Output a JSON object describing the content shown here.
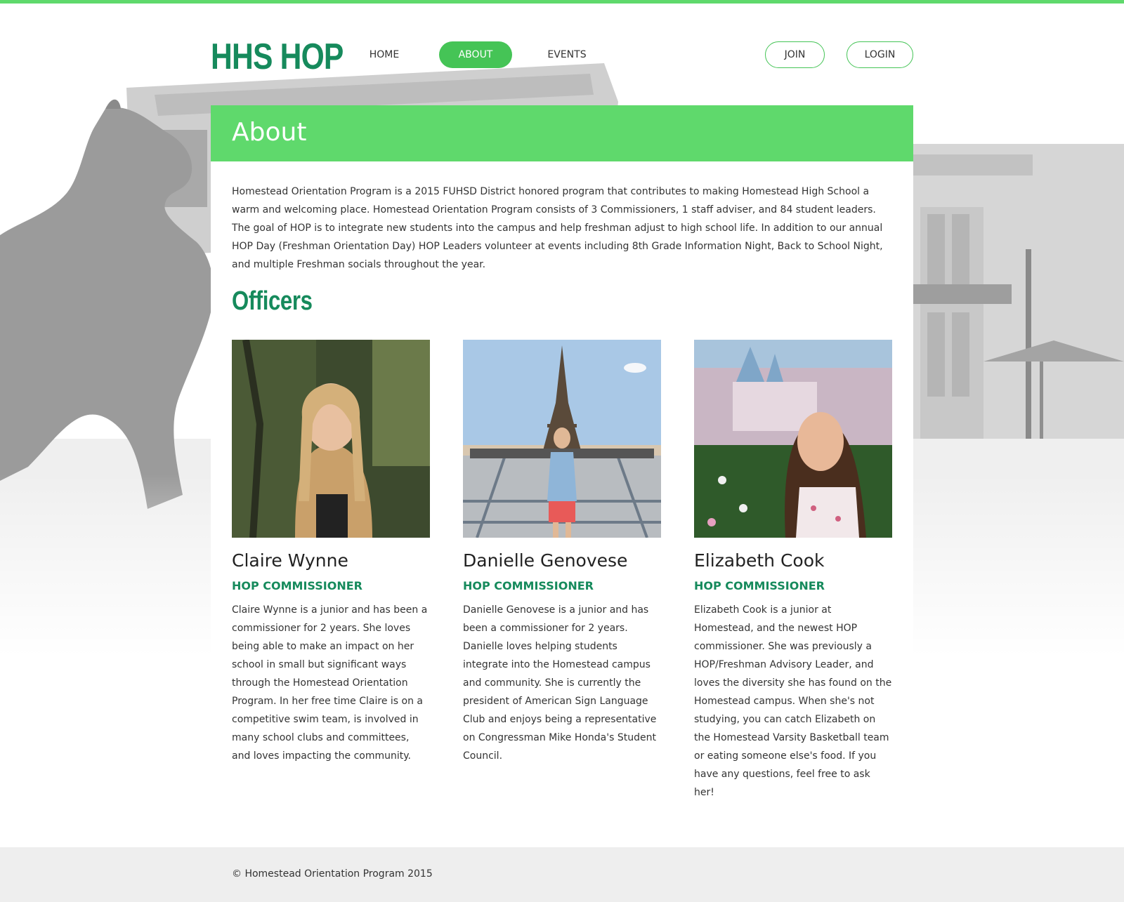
{
  "brand": {
    "logo": "HHS HOP",
    "accent": "#45c456",
    "brand_green": "#168a5c"
  },
  "nav": {
    "items": [
      {
        "label": "HOME",
        "active": false
      },
      {
        "label": "ABOUT",
        "active": true
      },
      {
        "label": "EVENTS",
        "active": false
      }
    ],
    "join_label": "JOIN",
    "login_label": "LOGIN"
  },
  "page": {
    "title": "About",
    "intro": "Homestead Orientation Program is a 2015 FUHSD District honored program that contributes to making Homestead High School a warm and welcoming place. Homestead Orientation Program consists of 3 Commissioners, 1 staff adviser, and 84 student leaders. The goal of HOP is to integrate new students into the campus and help freshman adjust to high school life. In addition to our annual HOP Day (Freshman Orientation Day) HOP Leaders volunteer at events including 8th Grade Information Night, Back to School Night, and multiple Freshman socials throughout the year.",
    "officers_heading": "Officers"
  },
  "officers": [
    {
      "name": "Claire Wynne",
      "role": "HOP COMMISSIONER",
      "bio": "Claire Wynne is a junior and has been a commissioner for 2 years. She loves being able to make an impact on her school in small but significant ways through the Homestead Orientation Program. In her free time Claire is on a competitive swim team, is involved in many school clubs and committees, and loves impacting the community."
    },
    {
      "name": "Danielle Genovese",
      "role": "HOP COMMISSIONER",
      "bio": "Danielle Genovese is a junior and has been a commissioner for 2 years. Danielle loves helping students integrate into the Homestead campus and community. She is currently the president of American Sign Language Club and enjoys being a representative on Congressman Mike Honda's Student Council."
    },
    {
      "name": "Elizabeth Cook",
      "role": "HOP COMMISSIONER",
      "bio": "Elizabeth Cook is a junior at Homestead, and the newest HOP commissioner. She was previously a HOP/Freshman Advisory Leader, and loves the diversity she has found on the Homestead campus. When she's not studying, you can catch Elizabeth on the Homestead Varsity Basketball team or eating someone else's food. If you have any questions, feel free to ask her!"
    }
  ],
  "footer": {
    "copyright": "© Homestead Orientation Program 2015"
  }
}
